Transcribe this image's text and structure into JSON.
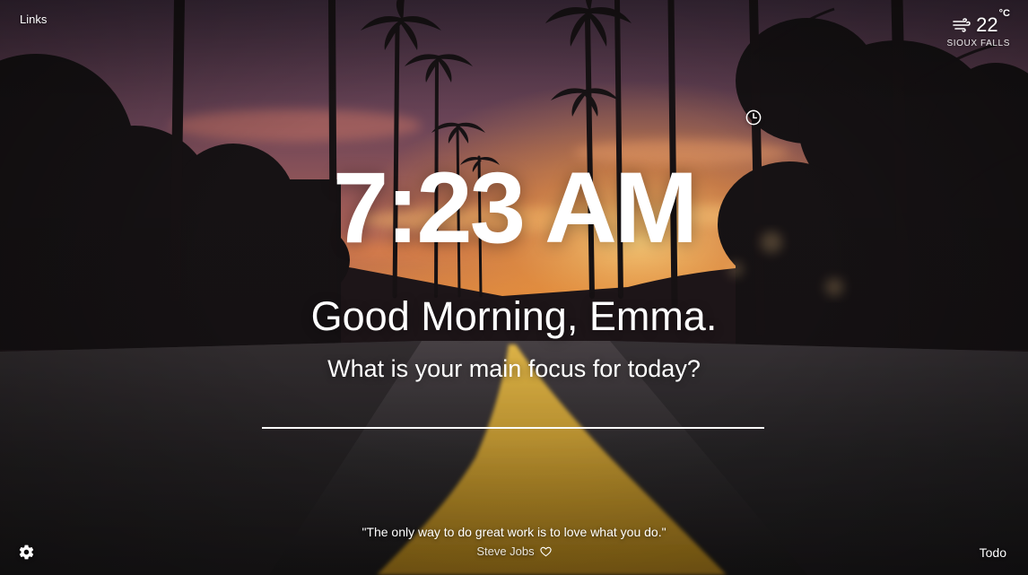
{
  "top": {
    "links_label": "Links"
  },
  "weather": {
    "icon": "wind-icon",
    "temperature": "22",
    "unit": "°C",
    "location": "SIOUX FALLS"
  },
  "clock": {
    "time": "7:23 AM",
    "toggle_icon": "clock-icon"
  },
  "greeting": {
    "text": "Good Morning, Emma."
  },
  "focus": {
    "question": "What is your main focus for today?",
    "input_value": ""
  },
  "quote": {
    "text": "\"The only way to do great work is to love what you do.\"",
    "author": "Steve Jobs",
    "favorite_icon": "heart-outline-icon"
  },
  "bottom": {
    "settings_icon": "gear-icon",
    "todo_label": "Todo"
  },
  "colors": {
    "text": "#ffffff",
    "sky_top": "#4a3348",
    "sky_glow": "#f2a23c",
    "road_line": "#d9a51c"
  }
}
